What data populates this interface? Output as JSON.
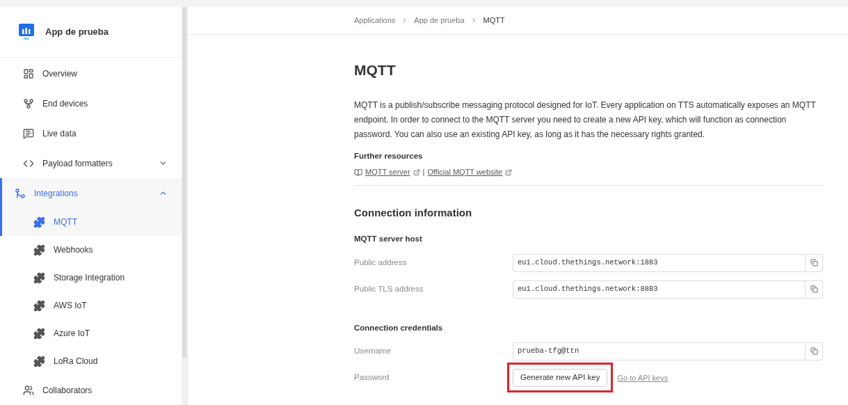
{
  "sidebar": {
    "app_name": "App de prueba",
    "items": [
      {
        "label": "Overview",
        "kind": "overview",
        "selected": false
      },
      {
        "label": "End devices",
        "kind": "devices",
        "selected": false
      },
      {
        "label": "Live data",
        "kind": "live",
        "selected": false
      },
      {
        "label": "Payload formatters",
        "kind": "code",
        "selected": false,
        "expanded": false
      },
      {
        "label": "Integrations",
        "kind": "integrations",
        "selected": true,
        "expanded": true,
        "children": [
          {
            "label": "MQTT",
            "selected": true
          },
          {
            "label": "Webhooks",
            "selected": false
          },
          {
            "label": "Storage Integration",
            "selected": false
          },
          {
            "label": "AWS IoT",
            "selected": false
          },
          {
            "label": "Azure IoT",
            "selected": false
          },
          {
            "label": "LoRa Cloud",
            "selected": false
          }
        ]
      },
      {
        "label": "Collaborators",
        "kind": "people",
        "selected": false
      }
    ]
  },
  "breadcrumb": [
    "Applications",
    "App de prueba",
    "MQTT"
  ],
  "title": "MQTT",
  "description": "MQTT is a publish/subscribe messaging protocol designed for IoT. Every application on TTS automatically exposes an MQTT endpoint. In order to connect to the MQTT server you need to create a new API key, which will function as connection password. You can also use an existing API key, as long as it has the necessary rights granted.",
  "resources": {
    "heading": "Further resources",
    "links": [
      "MQTT server",
      "Official MQTT website"
    ],
    "separator": "|"
  },
  "connection": {
    "heading": "Connection information",
    "sections": [
      {
        "heading": "MQTT server host",
        "rows": [
          {
            "label": "Public address",
            "kind": "field",
            "value": "eu1.cloud.thethings.network:1883"
          },
          {
            "label": "Public TLS address",
            "kind": "field",
            "value": "eu1.cloud.thethings.network:8883"
          }
        ]
      },
      {
        "heading": "Connection credentials",
        "rows": [
          {
            "label": "Username",
            "kind": "field",
            "value": "prueba-tfg@ttn"
          },
          {
            "label": "Password",
            "kind": "action",
            "button": "Generate new API key",
            "link": "Go to API keys",
            "highlighted": true
          }
        ]
      }
    ]
  }
}
